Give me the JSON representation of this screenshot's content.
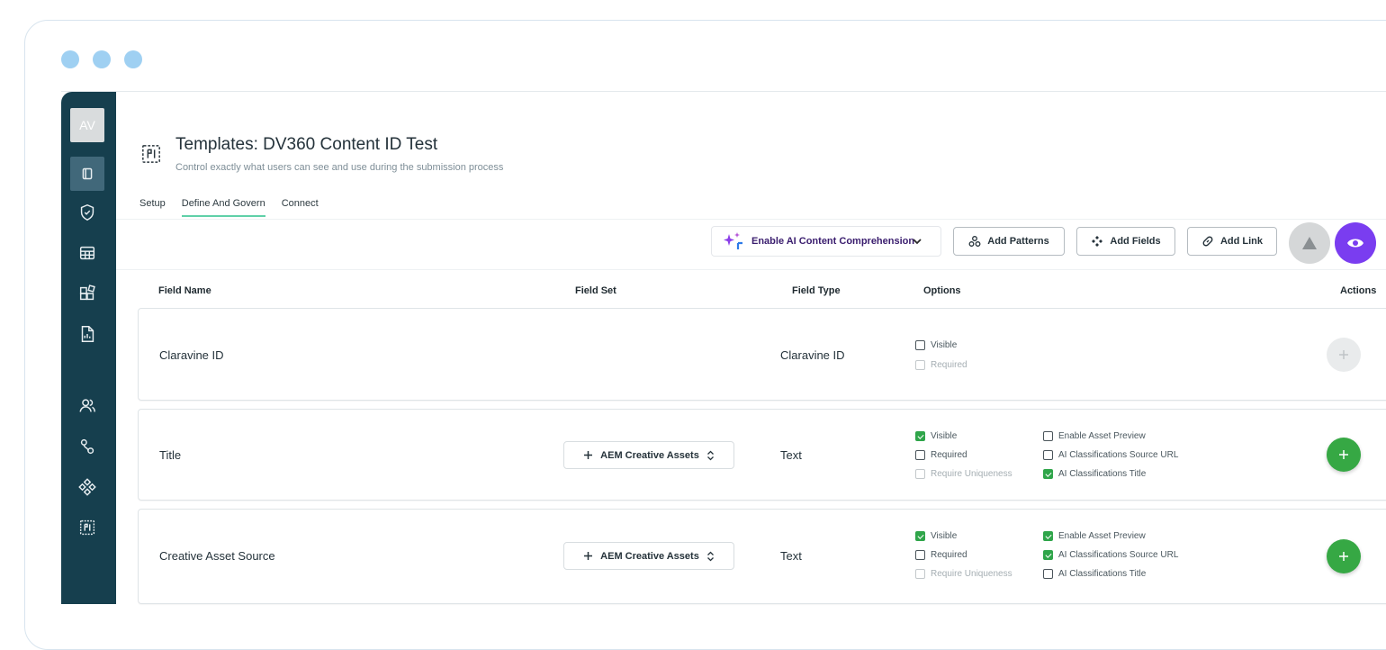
{
  "sidebar": {
    "avatar": "AV",
    "items": [
      {
        "icon": "panel-icon"
      },
      {
        "icon": "shield-check-icon"
      },
      {
        "icon": "table-icon"
      },
      {
        "icon": "blocks-icon"
      },
      {
        "icon": "report-icon"
      },
      {
        "icon": "users-icon"
      },
      {
        "icon": "flow-icon"
      },
      {
        "icon": "diamond-grid-icon"
      },
      {
        "icon": "template-icon"
      }
    ]
  },
  "header": {
    "title": "Templates: DV360 Content ID Test",
    "subtitle": "Control exactly what users can see and use during the submission process"
  },
  "tabs": [
    {
      "label": "Setup",
      "active": false
    },
    {
      "label": "Define And Govern",
      "active": true
    },
    {
      "label": "Connect",
      "active": false
    }
  ],
  "toolbar": {
    "ai_label": "Enable AI Content Comprehension",
    "add_patterns": "Add Patterns",
    "add_fields": "Add Fields",
    "add_link": "Add Link",
    "accent_color": "#7a3df0"
  },
  "columns": {
    "field_name": "Field Name",
    "field_set": "Field Set",
    "field_type": "Field Type",
    "options": "Options",
    "actions": "Actions"
  },
  "rows": [
    {
      "name": "Claravine ID",
      "field_set": "",
      "type": "Claravine ID",
      "options": [
        {
          "label": "Visible",
          "checked": false,
          "disabled": false
        },
        {
          "label": "Required",
          "checked": false,
          "disabled": true
        }
      ]
    },
    {
      "name": "Title",
      "field_set": "AEM Creative Assets",
      "type": "Text",
      "options": [
        {
          "label": "Visible",
          "checked": true,
          "disabled": false
        },
        {
          "label": "Required",
          "checked": false,
          "disabled": false
        },
        {
          "label": "Require Uniqueness",
          "checked": false,
          "disabled": true
        },
        {
          "label": "Enable Asset Preview",
          "checked": false,
          "disabled": false
        },
        {
          "label": "AI Classifications Source URL",
          "checked": false,
          "disabled": false
        },
        {
          "label": "AI Classifications Title",
          "checked": true,
          "disabled": false
        }
      ]
    },
    {
      "name": "Creative Asset Source",
      "field_set": "AEM Creative Assets",
      "type": "Text",
      "options": [
        {
          "label": "Visible",
          "checked": true,
          "disabled": false
        },
        {
          "label": "Required",
          "checked": false,
          "disabled": false
        },
        {
          "label": "Require Uniqueness",
          "checked": false,
          "disabled": true
        },
        {
          "label": "Enable Asset Preview",
          "checked": true,
          "disabled": false
        },
        {
          "label": "AI Classifications Source URL",
          "checked": true,
          "disabled": false
        },
        {
          "label": "AI Classifications Title",
          "checked": false,
          "disabled": false
        }
      ]
    }
  ]
}
